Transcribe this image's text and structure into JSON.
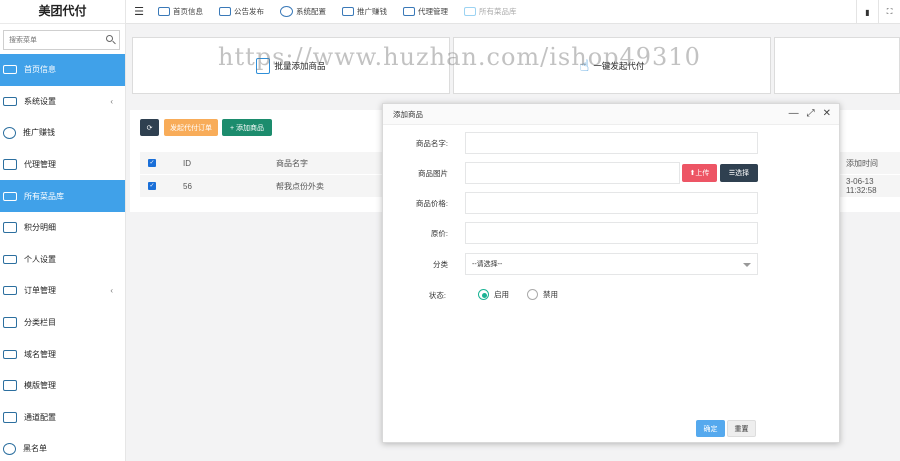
{
  "app": {
    "brand": "美团代付"
  },
  "sidebar": {
    "search_placeholder": "搜索菜单",
    "items": [
      {
        "label": "首页信息",
        "icon": "monitor-icon",
        "active": true
      },
      {
        "label": "系统设置",
        "icon": "settings-panel-icon",
        "has_submenu": true
      },
      {
        "label": "推广赚钱",
        "icon": "share-icon"
      },
      {
        "label": "代理管理",
        "icon": "shop-icon"
      },
      {
        "label": "所有菜品库",
        "icon": "database-icon",
        "active": true
      },
      {
        "label": "积分明细",
        "icon": "wallet-icon"
      },
      {
        "label": "个人设置",
        "icon": "profile-card-icon"
      },
      {
        "label": "订单管理",
        "icon": "order-icon",
        "has_submenu": true
      },
      {
        "label": "分类栏目",
        "icon": "sort-icon"
      },
      {
        "label": "域名管理",
        "icon": "domain-icon"
      },
      {
        "label": "模版管理",
        "icon": "template-icon"
      },
      {
        "label": "通道配置",
        "icon": "channel-icon"
      },
      {
        "label": "黑名单",
        "icon": "blacklist-icon"
      }
    ],
    "submenu_chevron": "‹"
  },
  "topbar": {
    "menu_icon": "☰",
    "tabs": [
      {
        "label": "首页信息",
        "icon": "monitor-icon"
      },
      {
        "label": "公告发布",
        "icon": "megaphone-icon"
      },
      {
        "label": "系统配置",
        "icon": "gear-ring-icon"
      },
      {
        "label": "推广赚钱",
        "icon": "share-icon"
      },
      {
        "label": "代理管理",
        "icon": "shop-icon"
      },
      {
        "label": "所有菜品库",
        "icon": "database-icon",
        "current": true
      }
    ],
    "right_icons": [
      "trash-icon",
      "fullscreen-icon"
    ]
  },
  "cards": [
    {
      "label": "批量添加商品",
      "icon": "batch-add-icon"
    },
    {
      "label": "一键发起代付",
      "icon": "tap-icon"
    },
    {
      "label": "",
      "icon": ""
    }
  ],
  "toolbar": {
    "refresh_icon": "⟳",
    "batch_label": "发起代付订单",
    "add_label": "+ 添加商品"
  },
  "table": {
    "columns": [
      "ID",
      "商品名字",
      "添加时间"
    ],
    "rows": [
      {
        "id": "56",
        "name": "帮我点份外卖",
        "time": "3-06-13 11:32:58"
      }
    ]
  },
  "modal": {
    "title": "添加商品",
    "controls": [
      "—",
      "⤢",
      "✕"
    ],
    "fields": {
      "name_label": "商品名字:",
      "name_value": "",
      "image_label": "商品图片",
      "image_value": "",
      "upload_label": "⬆上传",
      "choose_label": "☰选择",
      "price_label": "商品价格:",
      "price_value": "",
      "original_label": "原价:",
      "original_value": "",
      "category_label": "分类",
      "category_value": "--请选择--",
      "status_label": "状态:",
      "status_options": [
        "启用",
        "禁用"
      ],
      "status_selected": "启用"
    },
    "ok_label": "确定",
    "reset_label": "重置"
  },
  "watermark": "https://www.huzhan.com/ishop49310"
}
